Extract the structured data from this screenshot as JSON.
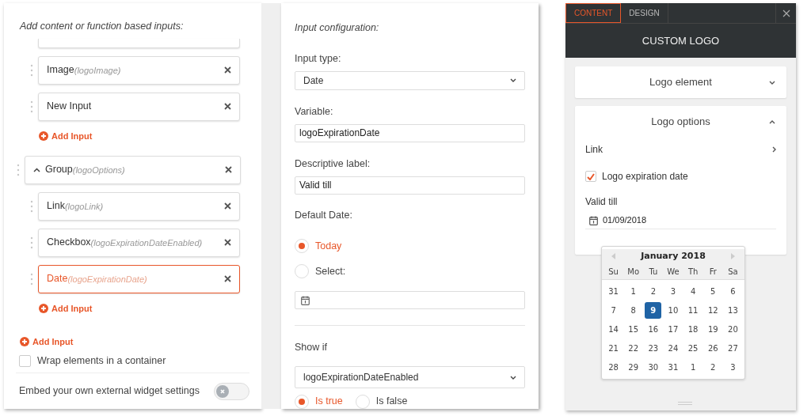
{
  "inputs_panel": {
    "heading": "Add content or function based inputs:",
    "items": [
      {
        "kind": "continued",
        "children": [
          {
            "kind": "input",
            "label": "Image",
            "variable": "(logoImage)",
            "selected": false
          },
          {
            "kind": "input",
            "label": "New Input",
            "selected": false
          },
          {
            "kind": "add",
            "label": "Add Input"
          }
        ]
      },
      {
        "kind": "group",
        "label": "Group",
        "variable": "(logoOptions)",
        "expanded": true,
        "selected": false,
        "children": [
          {
            "kind": "input",
            "label": "Link",
            "variable": "(logoLink)",
            "selected": false
          },
          {
            "kind": "input",
            "label": "Checkbox",
            "variable": "(logoExpirationDateEnabled)",
            "selected": false
          },
          {
            "kind": "input",
            "label": "Date",
            "variable": "(logoExpirationDate)",
            "selected": true
          },
          {
            "kind": "add",
            "label": "Add Input"
          }
        ]
      },
      {
        "kind": "add",
        "label": "Add Input"
      }
    ],
    "wrap": {
      "label": "Wrap elements in a container",
      "checked": false
    },
    "embed": {
      "label": "Embed your own external widget settings",
      "on": false
    }
  },
  "config_panel": {
    "heading": "Input configuration:",
    "input_type": {
      "label": "Input type:",
      "value": "Date"
    },
    "variable": {
      "label": "Variable:",
      "value": "logoExpirationDate"
    },
    "descriptive_label": {
      "label": "Descriptive label:",
      "value": "Valid till"
    },
    "default_date": {
      "label": "Default Date:",
      "options": [
        {
          "label": "Today",
          "selected": true
        },
        {
          "label": "Select:",
          "selected": false
        }
      ]
    },
    "show_if": {
      "label": "Show if",
      "value": "logoExpirationDateEnabled",
      "options": [
        {
          "label": "Is true",
          "selected": true
        },
        {
          "label": "Is false",
          "selected": false
        }
      ]
    }
  },
  "preview": {
    "tabs": [
      {
        "label": "CONTENT",
        "selected": true
      },
      {
        "label": "DESIGN",
        "selected": false
      }
    ],
    "title": "CUSTOM LOGO",
    "sections": [
      {
        "label": "Logo element",
        "expanded": false
      },
      {
        "label": "Logo options",
        "expanded": true
      }
    ],
    "link": "Link",
    "expiration": {
      "label": "Logo expiration date",
      "checked": true
    },
    "valid_till": {
      "label": "Valid till",
      "value": "01/09/2018"
    },
    "calendar": {
      "month": "January 2018",
      "weekdays": [
        "Su",
        "Mo",
        "Tu",
        "We",
        "Th",
        "Fr",
        "Sa"
      ],
      "weeks": [
        [
          {
            "day": "31",
            "selected": false
          },
          {
            "day": "1",
            "selected": false
          },
          {
            "day": "2",
            "selected": false
          },
          {
            "day": "3",
            "selected": false
          },
          {
            "day": "4",
            "selected": false
          },
          {
            "day": "5",
            "selected": false
          },
          {
            "day": "6",
            "selected": false
          }
        ],
        [
          {
            "day": "7",
            "selected": false
          },
          {
            "day": "8",
            "selected": false
          },
          {
            "day": "9",
            "selected": true
          },
          {
            "day": "10",
            "selected": false
          },
          {
            "day": "11",
            "selected": false
          },
          {
            "day": "12",
            "selected": false
          },
          {
            "day": "13",
            "selected": false
          }
        ],
        [
          {
            "day": "14",
            "selected": false
          },
          {
            "day": "15",
            "selected": false
          },
          {
            "day": "16",
            "selected": false
          },
          {
            "day": "17",
            "selected": false
          },
          {
            "day": "18",
            "selected": false
          },
          {
            "day": "19",
            "selected": false
          },
          {
            "day": "20",
            "selected": false
          }
        ],
        [
          {
            "day": "21",
            "selected": false
          },
          {
            "day": "22",
            "selected": false
          },
          {
            "day": "23",
            "selected": false
          },
          {
            "day": "24",
            "selected": false
          },
          {
            "day": "25",
            "selected": false
          },
          {
            "day": "26",
            "selected": false
          },
          {
            "day": "27",
            "selected": false
          }
        ],
        [
          {
            "day": "28",
            "selected": false
          },
          {
            "day": "29",
            "selected": false
          },
          {
            "day": "30",
            "selected": false
          },
          {
            "day": "31",
            "selected": false
          },
          {
            "day": "1",
            "selected": false
          },
          {
            "day": "2",
            "selected": false
          },
          {
            "day": "3",
            "selected": false
          }
        ]
      ]
    }
  }
}
